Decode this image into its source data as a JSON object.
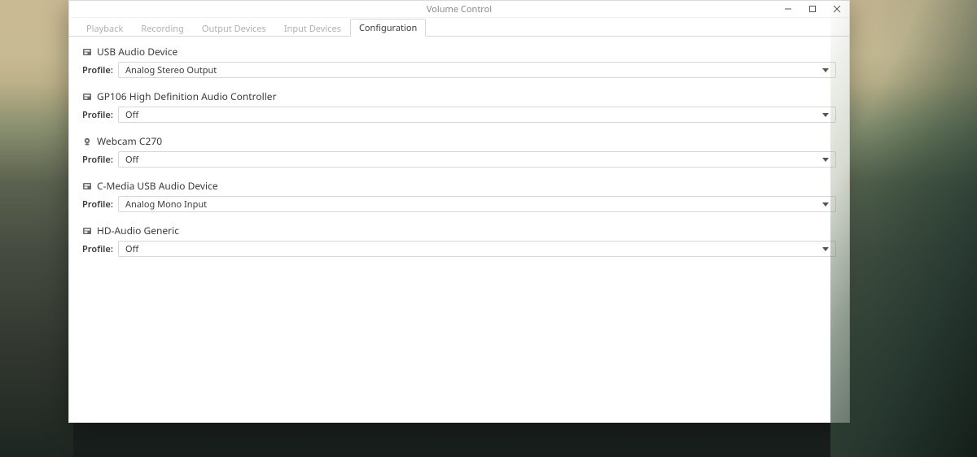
{
  "window": {
    "title": "Volume Control"
  },
  "tabs": [
    {
      "label": "Playback",
      "active": false
    },
    {
      "label": "Recording",
      "active": false
    },
    {
      "label": "Output Devices",
      "active": false
    },
    {
      "label": "Input Devices",
      "active": false
    },
    {
      "label": "Configuration",
      "active": true
    }
  ],
  "profile_label": "Profile:",
  "devices": [
    {
      "icon": "card",
      "name": "USB Audio Device",
      "profile_value": "Analog Stereo Output"
    },
    {
      "icon": "card",
      "name": "GP106 High Definition Audio Controller",
      "profile_value": "Off"
    },
    {
      "icon": "webcam",
      "name": "Webcam C270",
      "profile_value": "Off"
    },
    {
      "icon": "card",
      "name": "C-Media USB Audio Device",
      "profile_value": "Analog Mono Input"
    },
    {
      "icon": "card",
      "name": "HD-Audio Generic",
      "profile_value": "Off"
    }
  ]
}
